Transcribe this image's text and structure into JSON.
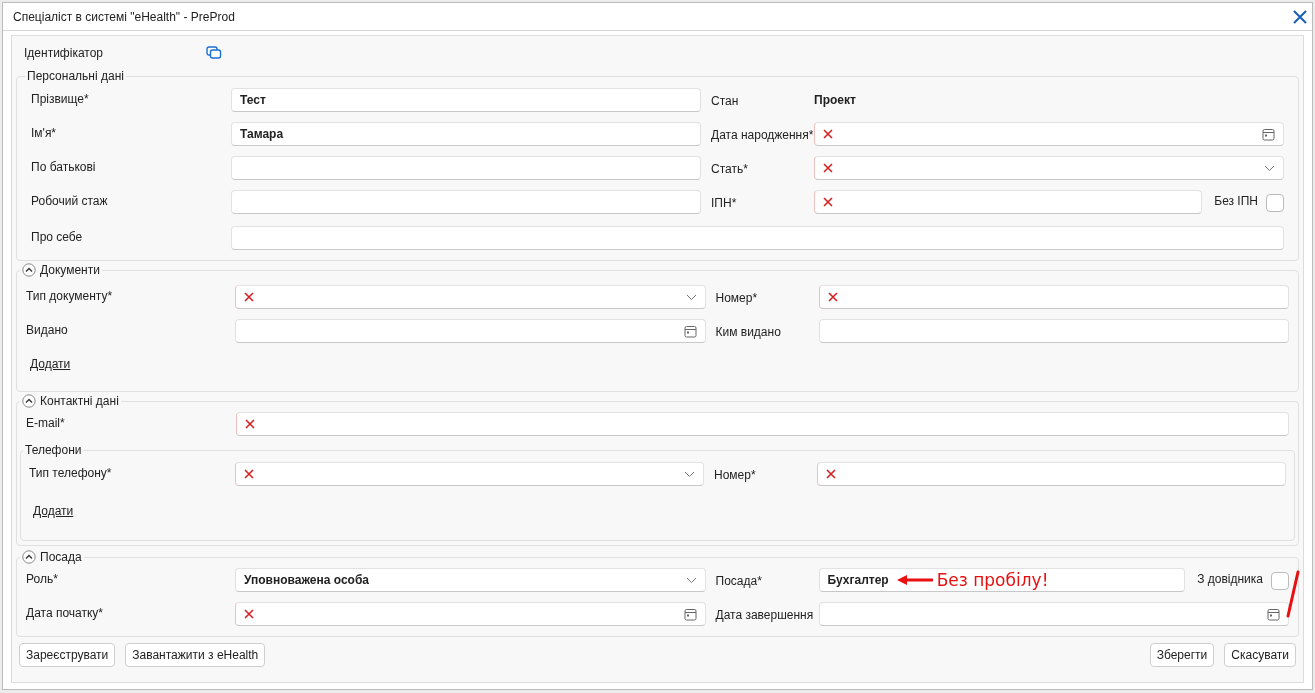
{
  "window": {
    "title": "Спеціаліст в системі \"eHealth\" - PreProd"
  },
  "identifier": {
    "label": "Ідентифікатор"
  },
  "personal": {
    "title": "Персональні дані",
    "rows": [
      {
        "left": {
          "label": "Прізвище*",
          "value": "Тест",
          "kind": "text",
          "invalid": false
        },
        "right": {
          "label": "Стан",
          "value": "Проект",
          "kind": "static"
        }
      },
      {
        "left": {
          "label": "Ім'я*",
          "value": "Тамара",
          "kind": "text",
          "invalid": false
        },
        "right": {
          "label": "Дата народження*",
          "kind": "date",
          "invalid": true
        }
      },
      {
        "left": {
          "label": "По батькові",
          "kind": "text",
          "invalid": false
        },
        "right": {
          "label": "Стать*",
          "kind": "select",
          "invalid": true
        }
      },
      {
        "left": {
          "label": "Робочий стаж",
          "kind": "text",
          "invalid": false
        },
        "right": {
          "label": "ІПН*",
          "kind": "text",
          "invalid": true,
          "checkbox": {
            "label": "Без ІПН",
            "checked": false
          }
        }
      }
    ],
    "full": {
      "label": "Про себе",
      "kind": "text",
      "invalid": false
    }
  },
  "documents": {
    "title": "Документи",
    "expanded": true,
    "rows": [
      {
        "left": {
          "label": "Тип документу*",
          "kind": "select",
          "invalid": true
        },
        "right": {
          "label": "Номер*",
          "kind": "text",
          "invalid": true
        }
      },
      {
        "left": {
          "label": "Видано",
          "kind": "date",
          "invalid": false
        },
        "right": {
          "label": "Ким видано",
          "kind": "text",
          "invalid": false
        }
      }
    ],
    "link": "Додати"
  },
  "contacts": {
    "title": "Контактні дані",
    "expanded": true,
    "email": {
      "label": "E-mail*",
      "kind": "text",
      "invalid": true
    },
    "phones": {
      "title": "Телефони",
      "rows": [
        {
          "left": {
            "label": "Тип телефону*",
            "kind": "select",
            "invalid": true
          },
          "right": {
            "label": "Номер*",
            "kind": "text",
            "invalid": true
          }
        }
      ],
      "link": "Додати"
    }
  },
  "position": {
    "title": "Посада",
    "expanded": true,
    "rows": [
      {
        "left": {
          "label": "Роль*",
          "value": "Уповноважена особа",
          "kind": "select",
          "invalid": false
        },
        "right": {
          "label": "Посада*",
          "value": "Бухгалтер",
          "kind": "text",
          "invalid": false,
          "note": "Без пробілу!",
          "checkbox": {
            "label": "З довідника",
            "checked": false
          }
        }
      },
      {
        "left": {
          "label": "Дата початку*",
          "kind": "date",
          "invalid": true
        },
        "right": {
          "label": "Дата завершення",
          "kind": "date",
          "invalid": false
        }
      }
    ]
  },
  "buttons_left": [
    "Зареєструвати",
    "Завантажити з eHealth"
  ],
  "buttons_right": [
    "Зберегти",
    "Скасувати"
  ]
}
